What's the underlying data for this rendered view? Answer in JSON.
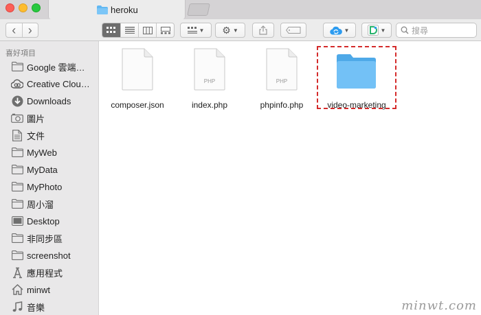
{
  "window": {
    "tab_title": "heroku"
  },
  "toolbar": {
    "back_label": "‹",
    "forward_label": "›",
    "search_placeholder": "搜尋"
  },
  "sidebar": {
    "header": "喜好項目",
    "items": [
      {
        "label": "Google 雲端…",
        "icon": "folder-icon"
      },
      {
        "label": "Creative Clou…",
        "icon": "creative-cloud-icon"
      },
      {
        "label": "Downloads",
        "icon": "download-icon"
      },
      {
        "label": "圖片",
        "icon": "camera-icon"
      },
      {
        "label": "文件",
        "icon": "document-icon"
      },
      {
        "label": "MyWeb",
        "icon": "folder-icon"
      },
      {
        "label": "MyData",
        "icon": "folder-icon"
      },
      {
        "label": "MyPhoto",
        "icon": "folder-icon"
      },
      {
        "label": "周小溜",
        "icon": "folder-icon"
      },
      {
        "label": "Desktop",
        "icon": "desktop-icon"
      },
      {
        "label": "非同步區",
        "icon": "folder-icon"
      },
      {
        "label": "screenshot",
        "icon": "folder-icon"
      },
      {
        "label": "應用程式",
        "icon": "applications-icon"
      },
      {
        "label": "minwt",
        "icon": "home-icon"
      },
      {
        "label": "音樂",
        "icon": "music-icon"
      }
    ]
  },
  "files": [
    {
      "name": "composer.json",
      "type": "document",
      "badge": ""
    },
    {
      "name": "index.php",
      "type": "document",
      "badge": "PHP"
    },
    {
      "name": "phpinfo.php",
      "type": "document",
      "badge": "PHP"
    },
    {
      "name": "video-marketing",
      "type": "folder",
      "badge": ""
    }
  ],
  "colors": {
    "highlight": "#d42a2a",
    "folder": "#62b8f2"
  },
  "watermark": "minwt.com"
}
